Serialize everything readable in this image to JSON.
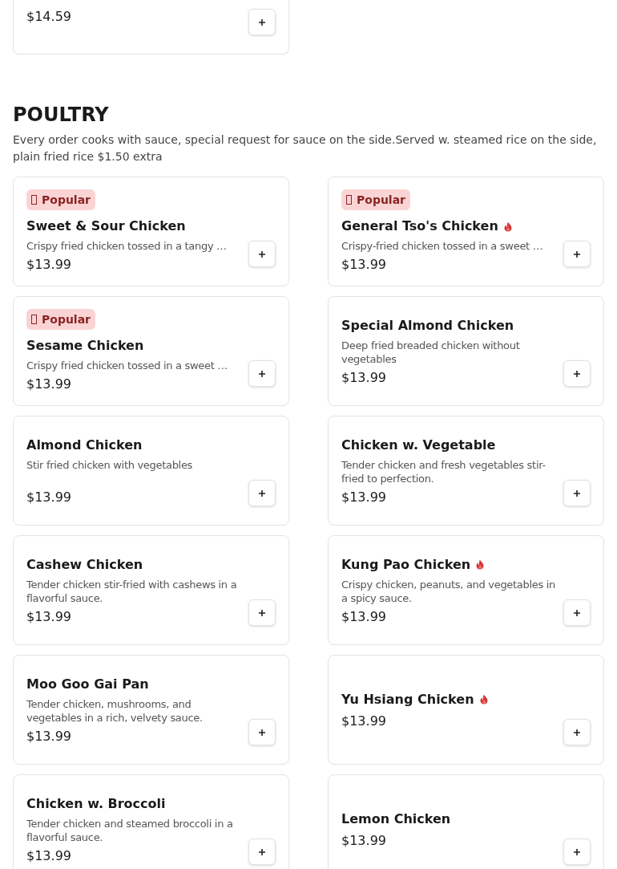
{
  "previous_item": {
    "price": "$14.59"
  },
  "section": {
    "title": "POULTRY",
    "description": "Every order cooks with sauce, special request for sauce on the side.Served w. steamed rice on the side, plain fried rice $1.50 extra"
  },
  "items": [
    {
      "popular": true,
      "badge": "Popular",
      "name": "Sweet & Sour Chicken",
      "spicy": false,
      "description": "Crispy fried chicken tossed in a tangy …",
      "price": "$13.99"
    },
    {
      "popular": true,
      "badge": "Popular",
      "name": "General Tso's Chicken",
      "spicy": true,
      "description": "Crispy-fried chicken tossed in a sweet …",
      "price": "$13.99"
    },
    {
      "popular": true,
      "badge": "Popular",
      "name": "Sesame Chicken",
      "spicy": false,
      "description": "Crispy fried chicken tossed in a sweet …",
      "price": "$13.99"
    },
    {
      "popular": false,
      "name": "Special Almond Chicken",
      "spicy": false,
      "description": "Deep fried breaded chicken without vegetables",
      "price": "$13.99"
    },
    {
      "popular": false,
      "name": "Almond Chicken",
      "spicy": false,
      "description": "Stir fried chicken with vegetables",
      "price": "$13.99"
    },
    {
      "popular": false,
      "name": "Chicken w. Vegetable",
      "spicy": false,
      "description": "Tender chicken and fresh vegetables stir-fried to perfection.",
      "price": "$13.99"
    },
    {
      "popular": false,
      "name": "Cashew Chicken",
      "spicy": false,
      "description": "Tender chicken stir-fried with cashews in a flavorful sauce.",
      "price": "$13.99"
    },
    {
      "popular": false,
      "name": "Kung Pao Chicken",
      "spicy": true,
      "description": "Crispy chicken, peanuts, and vegetables in a spicy sauce.",
      "price": "$13.99"
    },
    {
      "popular": false,
      "name": "Moo Goo Gai Pan",
      "spicy": false,
      "description": "Tender chicken, mushrooms, and vegetables in a rich, velvety sauce.",
      "price": "$13.99"
    },
    {
      "popular": false,
      "name": "Yu Hsiang Chicken",
      "spicy": true,
      "price": "$13.99"
    },
    {
      "popular": false,
      "name": "Chicken w. Broccoli",
      "spicy": false,
      "description": "Tender chicken and steamed broccoli in a flavorful sauce.",
      "price": "$13.99"
    },
    {
      "popular": false,
      "name": "Lemon Chicken",
      "spicy": false,
      "price": "$13.99"
    }
  ]
}
